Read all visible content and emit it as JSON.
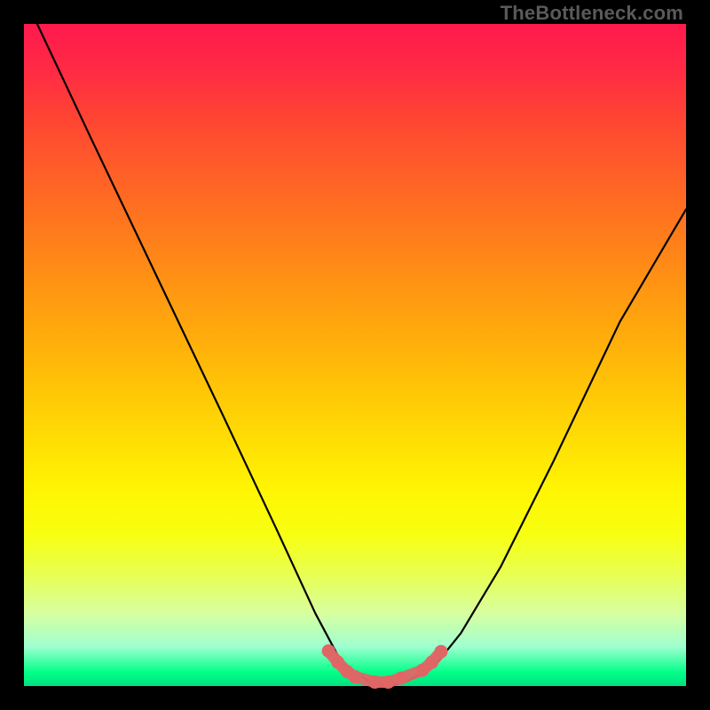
{
  "watermark": "TheBottleneck.com",
  "chart_data": {
    "type": "line",
    "title": "",
    "xlabel": "",
    "ylabel": "",
    "xlim": [
      0,
      100
    ],
    "ylim": [
      0,
      100
    ],
    "series": [
      {
        "name": "curve",
        "color": "#000000",
        "x": [
          2,
          10,
          20,
          30,
          38,
          44,
          48,
          52,
          54,
          56,
          58,
          62,
          66,
          72,
          80,
          90,
          100
        ],
        "y": [
          100,
          83,
          62,
          41,
          24,
          11,
          3.5,
          0.8,
          0.2,
          0.2,
          0.8,
          3.0,
          8,
          18,
          34,
          55,
          72
        ]
      }
    ],
    "markers": {
      "name": "trough-markers",
      "color": "#e06666",
      "x": [
        46.0,
        47.4,
        48.8,
        50.0,
        53.0,
        55.0,
        57.0,
        60.2,
        61.6,
        63.0
      ],
      "y": [
        5.3,
        3.6,
        2.2,
        1.4,
        0.6,
        0.6,
        1.2,
        2.4,
        3.6,
        5.2
      ]
    },
    "trough_band": {
      "color": "#e06666",
      "points_x": [
        46.0,
        47.4,
        48.8,
        50.0,
        53.0,
        55.0,
        57.0,
        60.2,
        61.6,
        63.0
      ],
      "points_y": [
        5.3,
        3.6,
        2.2,
        1.4,
        0.6,
        0.6,
        1.2,
        2.4,
        3.6,
        5.2
      ]
    }
  }
}
